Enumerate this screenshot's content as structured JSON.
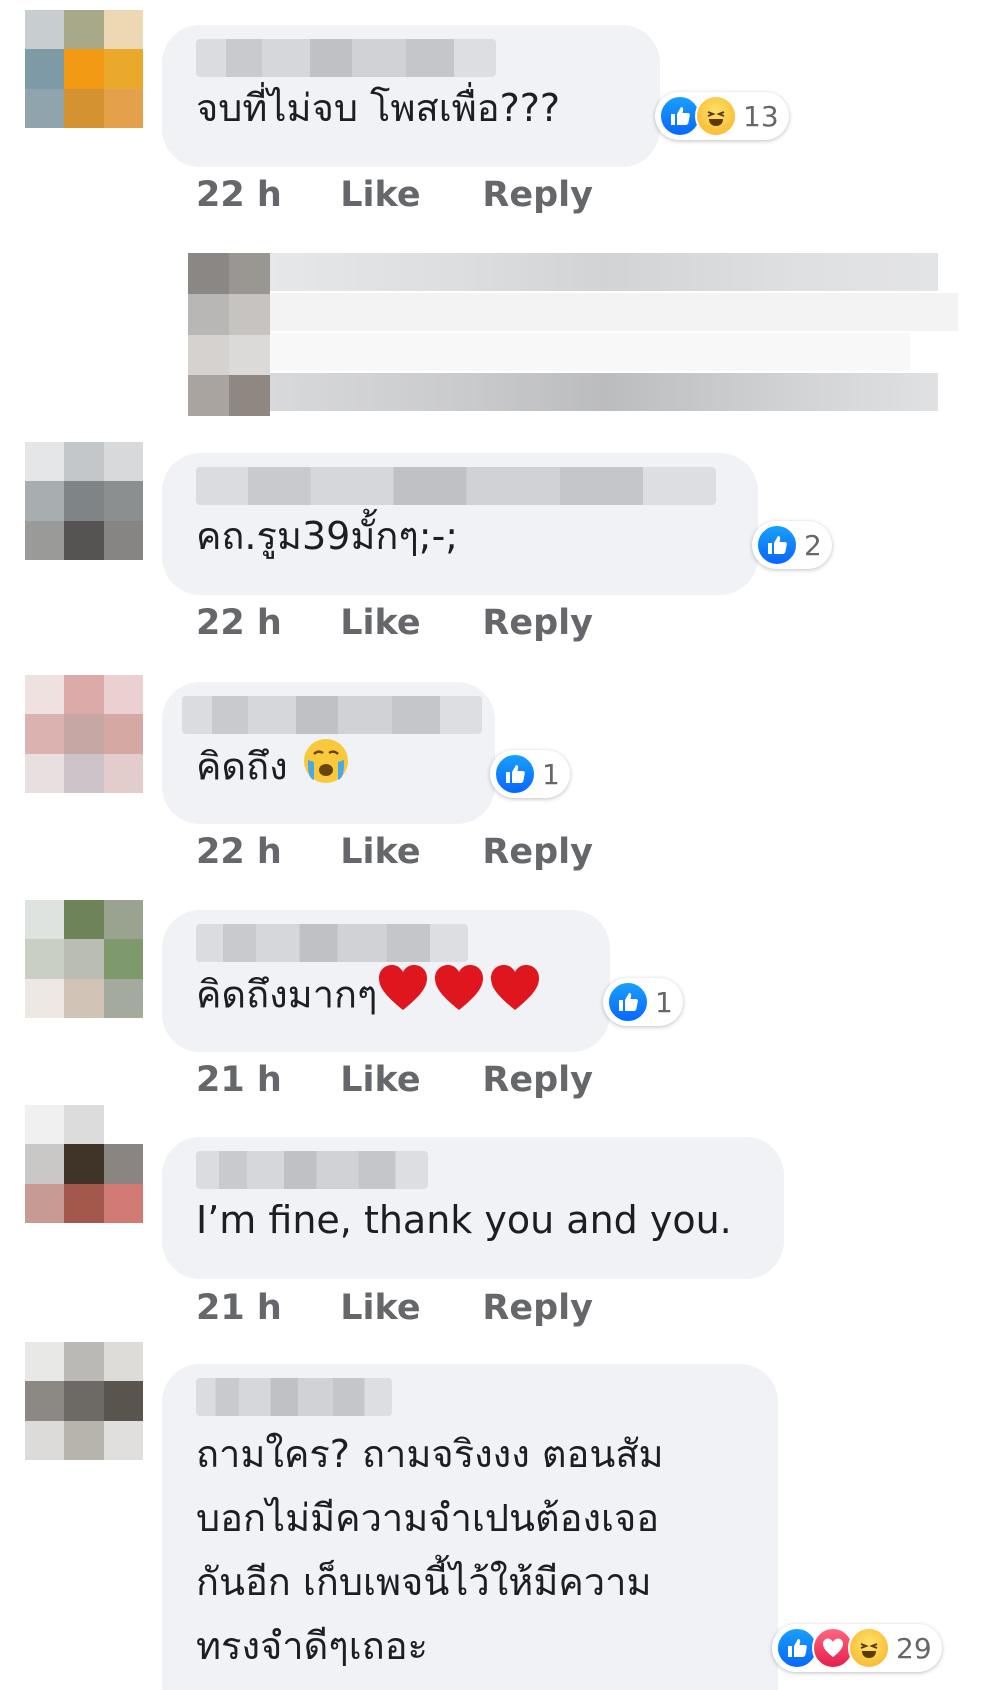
{
  "actions": {
    "like": "Like",
    "reply": "Reply"
  },
  "comments": [
    {
      "text": "จบที่ไม่จบ โพสเพื่อ???",
      "time": "22 h",
      "reactions": {
        "count": "13",
        "icons": [
          "like-icon",
          "haha-icon"
        ]
      }
    },
    {
      "text": "คถ.รูม39มั้กๆ;-;",
      "time": "22 h",
      "reactions": {
        "count": "2",
        "icons": [
          "like-icon"
        ]
      }
    },
    {
      "text": "คิดถึง",
      "emoji": "crying-face-emoji",
      "time": "22 h",
      "reactions": {
        "count": "1",
        "icons": [
          "like-icon"
        ]
      }
    },
    {
      "text": "คิดถึงมากๆ",
      "emoji": "three-red-hearts-emoji",
      "time": "21 h",
      "reactions": {
        "count": "1",
        "icons": [
          "like-icon"
        ]
      }
    },
    {
      "text": "I’m fine, thank you and you.",
      "time": "21 h"
    },
    {
      "text": "ถามใคร? ถามจริงงง ตอนสัม\nบอกไม่มีความจำเปนต้องเจอ\nกันอีก เก็บเพจนี้ไว้ให้มีความ\nทรงจำดีๆเถอะ",
      "time": "",
      "reactions": {
        "count": "29",
        "icons": [
          "like-icon",
          "love-icon",
          "haha-icon"
        ]
      }
    }
  ],
  "colors": {
    "bubble": "#f0f2f5",
    "meta_text": "#65676b",
    "like_blue": "#0866ff",
    "haha_yellow": "#f7b125",
    "love_red": "#e61e4d"
  }
}
